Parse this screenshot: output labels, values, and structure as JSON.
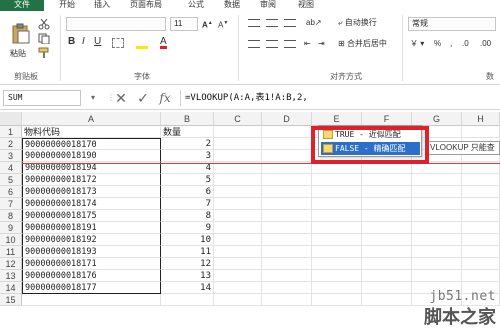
{
  "ribbon": {
    "tabs": [
      {
        "label": "文件",
        "key": "F"
      },
      {
        "label": "开始",
        "key": "H"
      },
      {
        "label": "插入",
        "key": "N"
      },
      {
        "label": "页面布局",
        "key": "P"
      },
      {
        "label": "公式",
        "key": "M"
      },
      {
        "label": "数据",
        "key": "A"
      },
      {
        "label": "审阅",
        "key": "R"
      },
      {
        "label": "视图",
        "key": "W"
      }
    ],
    "groups": {
      "clipboard": "剪贴板",
      "font": "字体",
      "alignment": "对齐方式",
      "number": "数"
    },
    "paste_label": "粘贴",
    "font_size": "11",
    "wrap_text": "自动换行",
    "merge_center": "合并后居中",
    "number_format": "常规",
    "cut_icon": "scissors-icon",
    "copy_icon": "copy-icon",
    "format_painter_icon": "brush-icon"
  },
  "formula_bar": {
    "name_box": "SUM",
    "cancel_symbol": "✕",
    "enter_symbol": "✓",
    "fx_symbol": "fx",
    "formula": "=VLOOKUP(A:A,表1!A:B,2,"
  },
  "sheet": {
    "columns": [
      "A",
      "B",
      "C",
      "D",
      "E",
      "F",
      "G",
      "H"
    ],
    "rows": [
      {
        "n": "1",
        "a": "物料代码",
        "b": "数量"
      },
      {
        "n": "2",
        "a": "90000000018170",
        "b": "2"
      },
      {
        "n": "3",
        "a": "90000000018190",
        "b": "3"
      },
      {
        "n": "4",
        "a": "90000000018194",
        "b": "4"
      },
      {
        "n": "5",
        "a": "90000000018172",
        "b": "5"
      },
      {
        "n": "6",
        "a": "90000000018173",
        "b": "6"
      },
      {
        "n": "7",
        "a": "90000000018174",
        "b": "7"
      },
      {
        "n": "8",
        "a": "90000000018175",
        "b": "8"
      },
      {
        "n": "9",
        "a": "90000000018191",
        "b": "9"
      },
      {
        "n": "10",
        "a": "90000000018192",
        "b": "10"
      },
      {
        "n": "11",
        "a": "90000000018193",
        "b": "11"
      },
      {
        "n": "12",
        "a": "90000000018171",
        "b": "12"
      },
      {
        "n": "13",
        "a": "90000000018176",
        "b": "13"
      },
      {
        "n": "14",
        "a": "90000000018177",
        "b": "14"
      },
      {
        "n": "15",
        "a": "",
        "b": ""
      }
    ]
  },
  "autocomplete": {
    "items": [
      "TRUE - 近似匹配",
      "FALSE - 精确匹配"
    ],
    "selected_index": 1,
    "tooltip": "VLOOKUP 只能查"
  },
  "watermark": {
    "line1": "jb51.net",
    "line2": "脚本之家"
  },
  "colors": {
    "excel_green": "#217346",
    "highlight_red": "#e0202a",
    "selection_blue": "#2b6fc9"
  }
}
